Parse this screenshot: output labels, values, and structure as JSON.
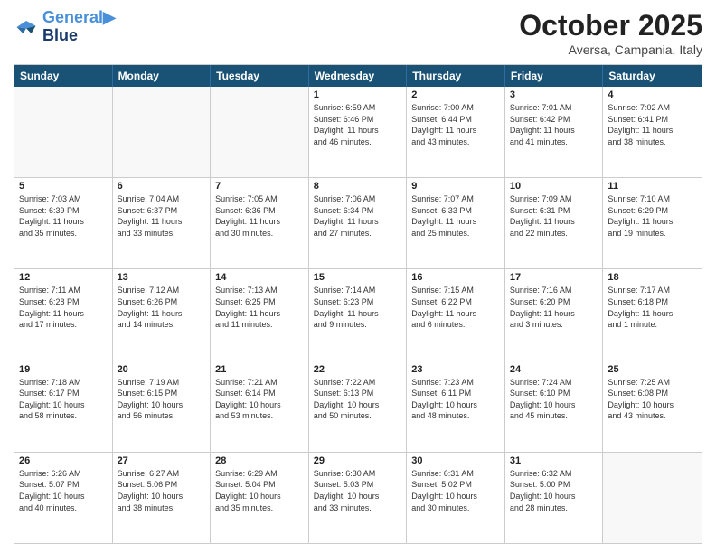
{
  "header": {
    "logo_line1": "General",
    "logo_line2": "Blue",
    "month": "October 2025",
    "location": "Aversa, Campania, Italy"
  },
  "weekdays": [
    "Sunday",
    "Monday",
    "Tuesday",
    "Wednesday",
    "Thursday",
    "Friday",
    "Saturday"
  ],
  "rows": [
    [
      {
        "day": "",
        "info": "",
        "empty": true
      },
      {
        "day": "",
        "info": "",
        "empty": true
      },
      {
        "day": "",
        "info": "",
        "empty": true
      },
      {
        "day": "1",
        "info": "Sunrise: 6:59 AM\nSunset: 6:46 PM\nDaylight: 11 hours\nand 46 minutes."
      },
      {
        "day": "2",
        "info": "Sunrise: 7:00 AM\nSunset: 6:44 PM\nDaylight: 11 hours\nand 43 minutes."
      },
      {
        "day": "3",
        "info": "Sunrise: 7:01 AM\nSunset: 6:42 PM\nDaylight: 11 hours\nand 41 minutes."
      },
      {
        "day": "4",
        "info": "Sunrise: 7:02 AM\nSunset: 6:41 PM\nDaylight: 11 hours\nand 38 minutes."
      }
    ],
    [
      {
        "day": "5",
        "info": "Sunrise: 7:03 AM\nSunset: 6:39 PM\nDaylight: 11 hours\nand 35 minutes."
      },
      {
        "day": "6",
        "info": "Sunrise: 7:04 AM\nSunset: 6:37 PM\nDaylight: 11 hours\nand 33 minutes."
      },
      {
        "day": "7",
        "info": "Sunrise: 7:05 AM\nSunset: 6:36 PM\nDaylight: 11 hours\nand 30 minutes."
      },
      {
        "day": "8",
        "info": "Sunrise: 7:06 AM\nSunset: 6:34 PM\nDaylight: 11 hours\nand 27 minutes."
      },
      {
        "day": "9",
        "info": "Sunrise: 7:07 AM\nSunset: 6:33 PM\nDaylight: 11 hours\nand 25 minutes."
      },
      {
        "day": "10",
        "info": "Sunrise: 7:09 AM\nSunset: 6:31 PM\nDaylight: 11 hours\nand 22 minutes."
      },
      {
        "day": "11",
        "info": "Sunrise: 7:10 AM\nSunset: 6:29 PM\nDaylight: 11 hours\nand 19 minutes."
      }
    ],
    [
      {
        "day": "12",
        "info": "Sunrise: 7:11 AM\nSunset: 6:28 PM\nDaylight: 11 hours\nand 17 minutes."
      },
      {
        "day": "13",
        "info": "Sunrise: 7:12 AM\nSunset: 6:26 PM\nDaylight: 11 hours\nand 14 minutes."
      },
      {
        "day": "14",
        "info": "Sunrise: 7:13 AM\nSunset: 6:25 PM\nDaylight: 11 hours\nand 11 minutes."
      },
      {
        "day": "15",
        "info": "Sunrise: 7:14 AM\nSunset: 6:23 PM\nDaylight: 11 hours\nand 9 minutes."
      },
      {
        "day": "16",
        "info": "Sunrise: 7:15 AM\nSunset: 6:22 PM\nDaylight: 11 hours\nand 6 minutes."
      },
      {
        "day": "17",
        "info": "Sunrise: 7:16 AM\nSunset: 6:20 PM\nDaylight: 11 hours\nand 3 minutes."
      },
      {
        "day": "18",
        "info": "Sunrise: 7:17 AM\nSunset: 6:18 PM\nDaylight: 11 hours\nand 1 minute."
      }
    ],
    [
      {
        "day": "19",
        "info": "Sunrise: 7:18 AM\nSunset: 6:17 PM\nDaylight: 10 hours\nand 58 minutes."
      },
      {
        "day": "20",
        "info": "Sunrise: 7:19 AM\nSunset: 6:15 PM\nDaylight: 10 hours\nand 56 minutes."
      },
      {
        "day": "21",
        "info": "Sunrise: 7:21 AM\nSunset: 6:14 PM\nDaylight: 10 hours\nand 53 minutes."
      },
      {
        "day": "22",
        "info": "Sunrise: 7:22 AM\nSunset: 6:13 PM\nDaylight: 10 hours\nand 50 minutes."
      },
      {
        "day": "23",
        "info": "Sunrise: 7:23 AM\nSunset: 6:11 PM\nDaylight: 10 hours\nand 48 minutes."
      },
      {
        "day": "24",
        "info": "Sunrise: 7:24 AM\nSunset: 6:10 PM\nDaylight: 10 hours\nand 45 minutes."
      },
      {
        "day": "25",
        "info": "Sunrise: 7:25 AM\nSunset: 6:08 PM\nDaylight: 10 hours\nand 43 minutes."
      }
    ],
    [
      {
        "day": "26",
        "info": "Sunrise: 6:26 AM\nSunset: 5:07 PM\nDaylight: 10 hours\nand 40 minutes."
      },
      {
        "day": "27",
        "info": "Sunrise: 6:27 AM\nSunset: 5:06 PM\nDaylight: 10 hours\nand 38 minutes."
      },
      {
        "day": "28",
        "info": "Sunrise: 6:29 AM\nSunset: 5:04 PM\nDaylight: 10 hours\nand 35 minutes."
      },
      {
        "day": "29",
        "info": "Sunrise: 6:30 AM\nSunset: 5:03 PM\nDaylight: 10 hours\nand 33 minutes."
      },
      {
        "day": "30",
        "info": "Sunrise: 6:31 AM\nSunset: 5:02 PM\nDaylight: 10 hours\nand 30 minutes."
      },
      {
        "day": "31",
        "info": "Sunrise: 6:32 AM\nSunset: 5:00 PM\nDaylight: 10 hours\nand 28 minutes."
      },
      {
        "day": "",
        "info": "",
        "empty": true
      }
    ]
  ]
}
